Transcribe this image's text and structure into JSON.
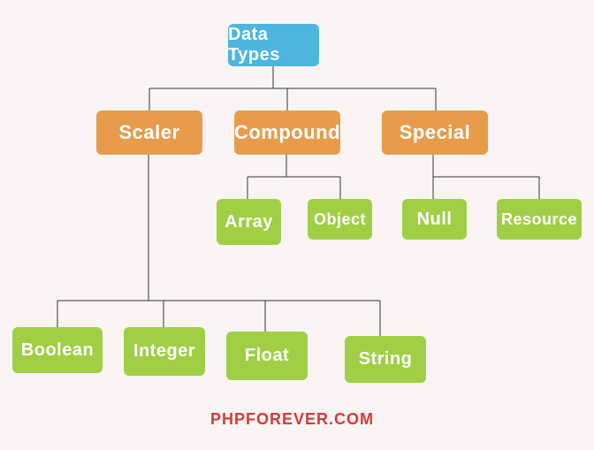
{
  "root": {
    "label": "Data Types"
  },
  "categories": {
    "scaler": {
      "label": "Scaler"
    },
    "compound": {
      "label": "Compound"
    },
    "special": {
      "label": "Special"
    }
  },
  "leaves": {
    "array": {
      "label": "Array"
    },
    "object": {
      "label": "Object"
    },
    "null": {
      "label": "Null"
    },
    "resource": {
      "label": "Resource"
    },
    "boolean": {
      "label": "Boolean"
    },
    "integer": {
      "label": "Integer"
    },
    "float": {
      "label": "Float"
    },
    "string": {
      "label": "String"
    }
  },
  "footer": {
    "text": "PHPFOREVER.COM"
  }
}
